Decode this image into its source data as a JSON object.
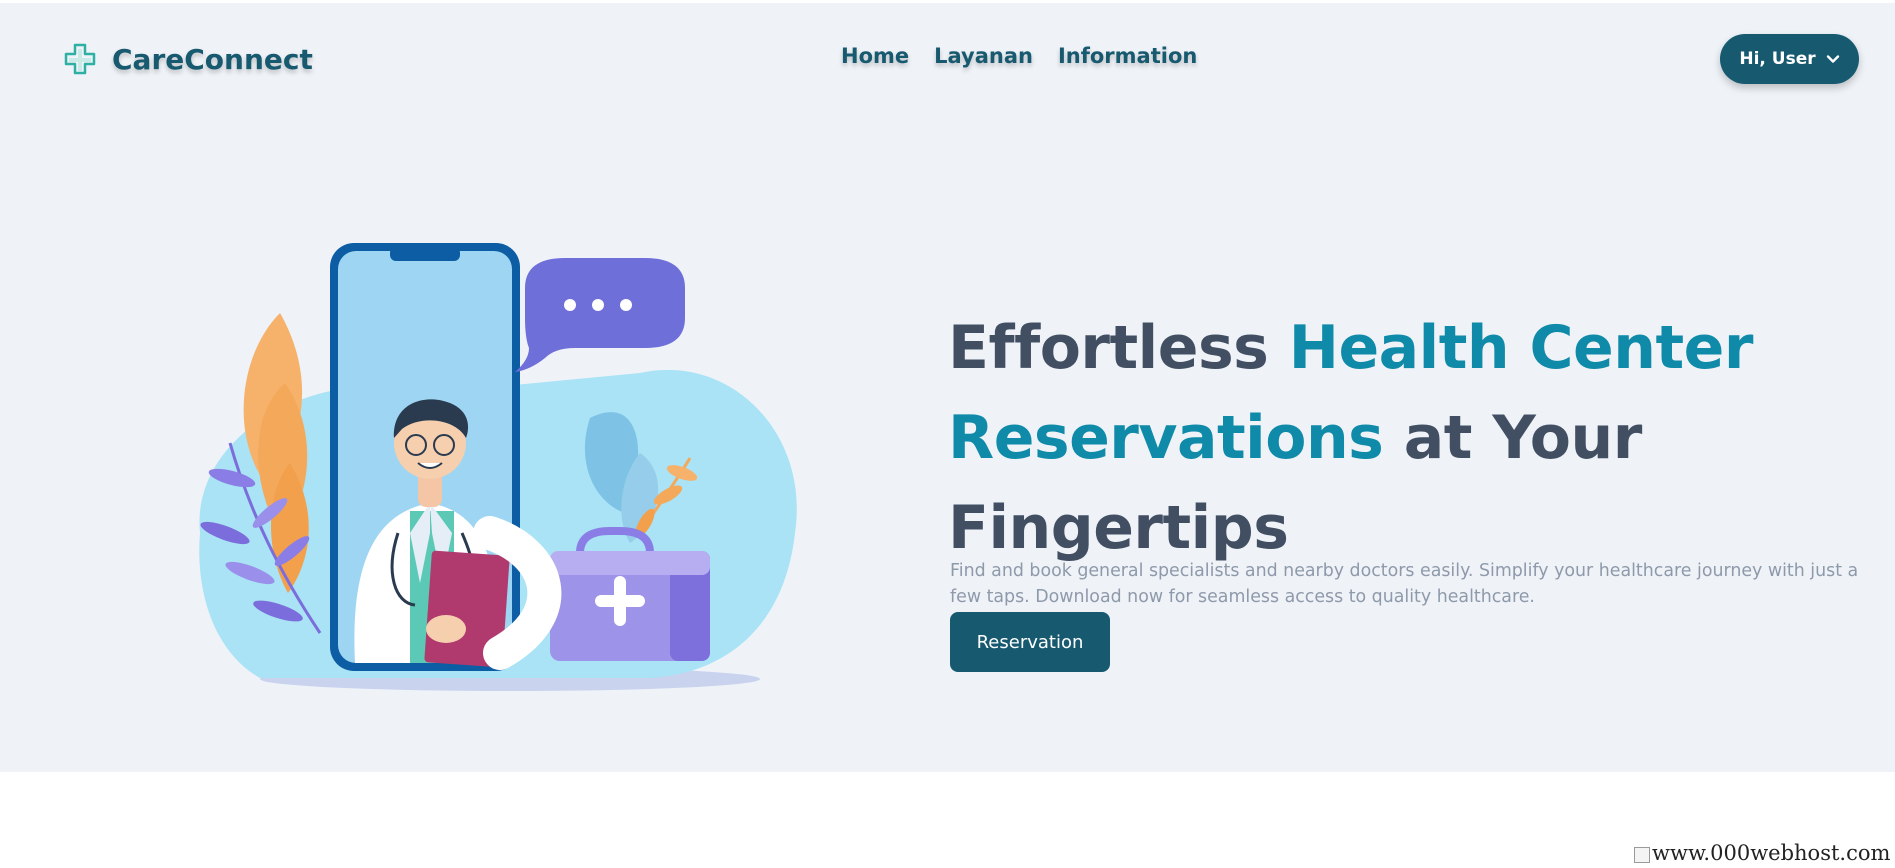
{
  "header": {
    "brand_name": "CareConnect",
    "nav": [
      {
        "label": "Home"
      },
      {
        "label": "Layanan"
      },
      {
        "label": "Information"
      }
    ],
    "user_menu_label": "Hi, User"
  },
  "hero": {
    "title_part1": "Effortless ",
    "title_highlight1": "Health Center",
    "title_highlight2": "Reservations",
    "title_part2": " at Your",
    "title_part3": "Fingertips",
    "description": "Find and book general specialists and nearby doctors easily. Simplify your healthcare journey with just a few taps. Download now for seamless access to quality healthcare.",
    "cta_label": "Reservation"
  },
  "footer_badge": {
    "alt_text": "www.000webhost.com"
  },
  "colors": {
    "primary": "#175a70",
    "accent": "#0f8aa8",
    "heading": "#424f63",
    "hero_bg": "#eff3f8"
  }
}
